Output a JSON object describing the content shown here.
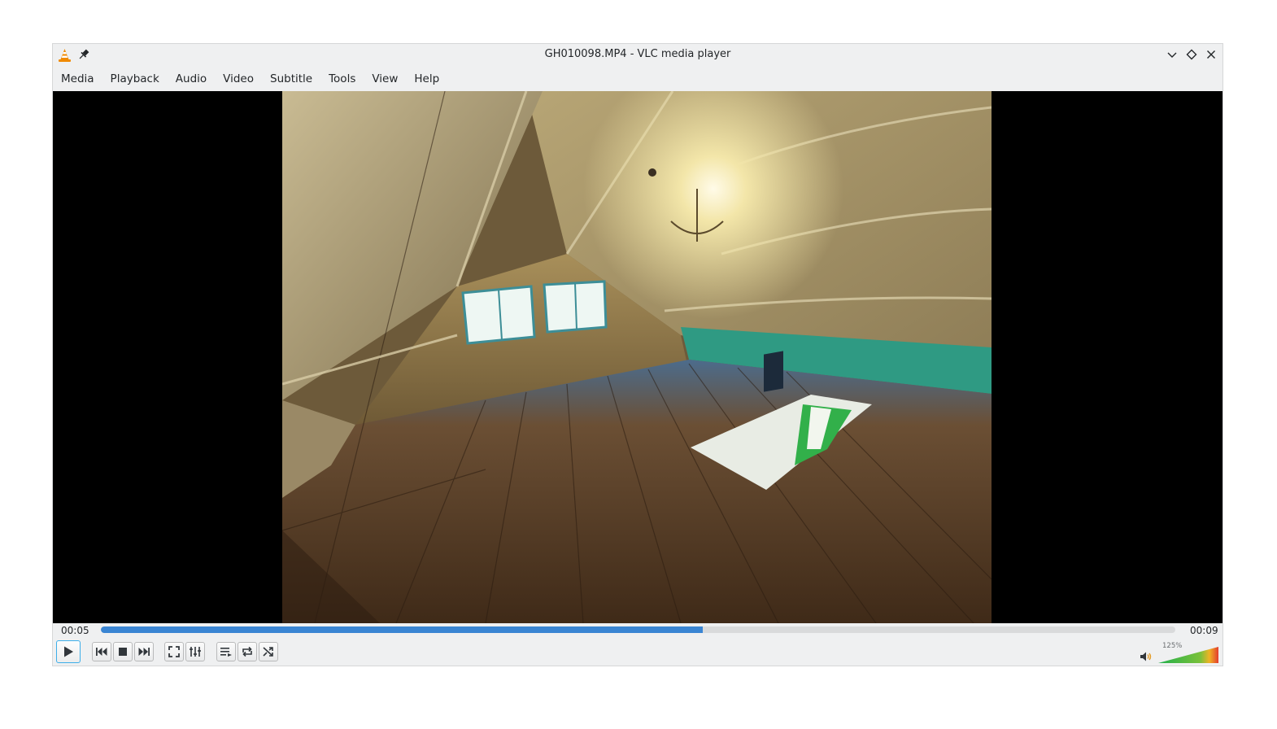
{
  "window": {
    "title": "GH010098.MP4 - VLC media player"
  },
  "titlebar": {
    "icons": [
      "vlc-cone-icon",
      "pin-icon",
      "minimize-icon",
      "maximize-icon",
      "close-icon"
    ]
  },
  "menu": {
    "items": [
      "Media",
      "Playback",
      "Audio",
      "Video",
      "Subtitle",
      "Tools",
      "View",
      "Help"
    ]
  },
  "video": {
    "description_icon": "video-frame"
  },
  "playback": {
    "elapsed": "00:05",
    "total": "00:09",
    "progress": 0.56
  },
  "controls": {
    "buttons": [
      "play-icon",
      "previous-icon",
      "stop-icon",
      "next-icon",
      "fullscreen-icon",
      "extended-settings-icon",
      "playlist-icon",
      "loop-icon",
      "shuffle-icon"
    ]
  },
  "volume": {
    "percent_label": "125%",
    "level": 1.0,
    "colors": {
      "low": "#21b04b",
      "high": "#e33d2f"
    }
  }
}
